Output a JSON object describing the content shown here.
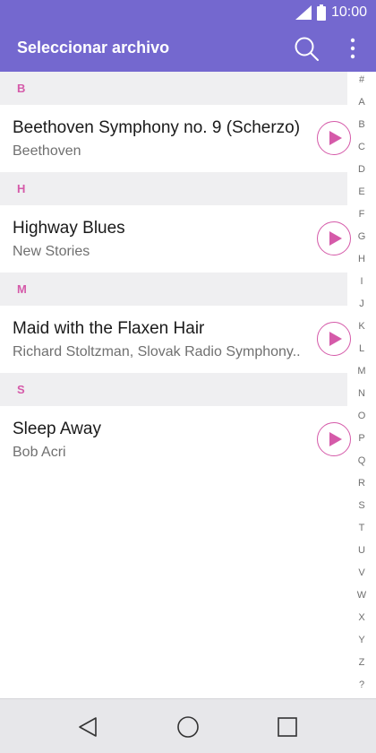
{
  "status_bar": {
    "time": "10:00"
  },
  "app_bar": {
    "title": "Seleccionar archivo",
    "search_icon": "search-icon",
    "more_icon": "more-vert-icon"
  },
  "sections": [
    {
      "letter": "B",
      "items": [
        {
          "title": "Beethoven Symphony no. 9 (Scherzo)",
          "artist": "Beethoven"
        }
      ]
    },
    {
      "letter": "H",
      "items": [
        {
          "title": "Highway Blues",
          "artist": "New Stories"
        }
      ]
    },
    {
      "letter": "M",
      "items": [
        {
          "title": "Maid with the Flaxen Hair",
          "artist": "Richard Stoltzman, Slovak Radio Symphony.."
        }
      ]
    },
    {
      "letter": "S",
      "items": [
        {
          "title": "Sleep Away",
          "artist": "Bob Acri"
        }
      ]
    }
  ],
  "index_letters": [
    "#",
    "A",
    "B",
    "C",
    "D",
    "E",
    "F",
    "G",
    "H",
    "I",
    "J",
    "K",
    "L",
    "M",
    "N",
    "O",
    "P",
    "Q",
    "R",
    "S",
    "T",
    "U",
    "V",
    "W",
    "X",
    "Y",
    "Z",
    "?"
  ],
  "colors": {
    "app_bar": "#7468cf",
    "accent": "#d55aa9",
    "section_bg": "#efeff1",
    "nav_bar": "#e7e7ea"
  },
  "nav_bar": {
    "back_icon": "back-icon",
    "home_icon": "home-icon",
    "recents_icon": "recents-icon"
  }
}
